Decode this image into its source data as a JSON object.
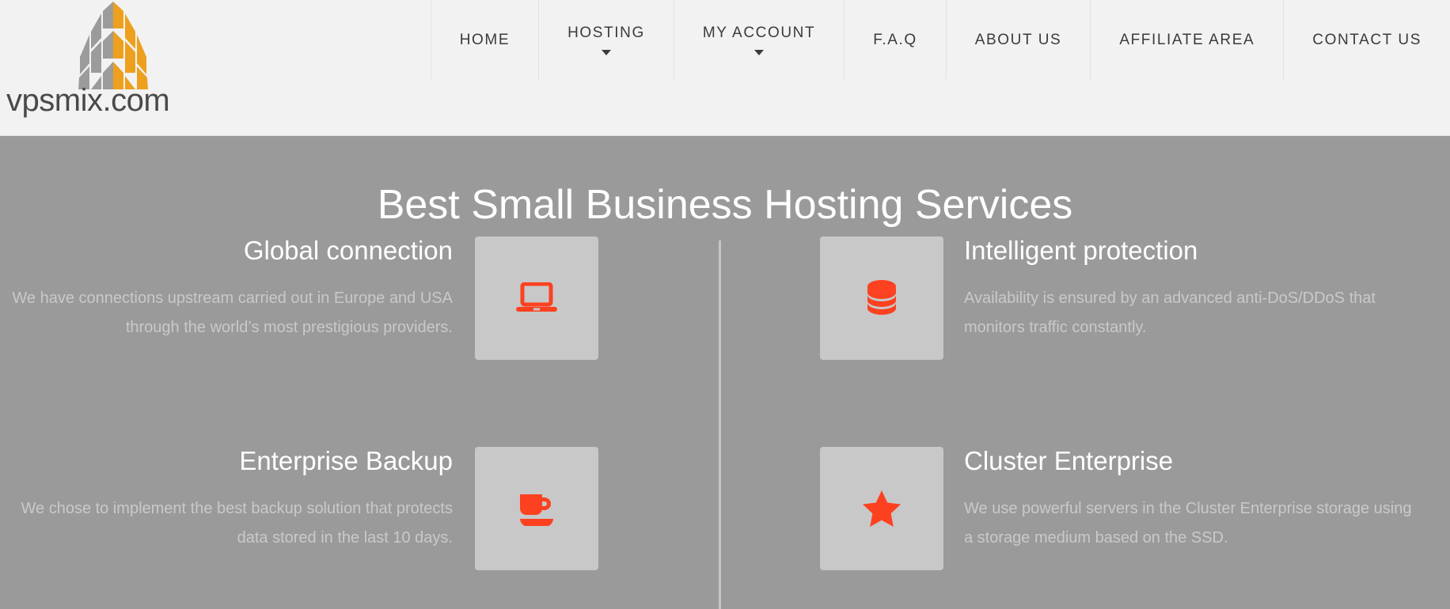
{
  "header": {
    "brand": {
      "name": "vpsmix.com",
      "logo_icon": "building-logo-icon",
      "logo_colors": {
        "gray": "#9b9b9b",
        "orange": "#eda01e"
      }
    },
    "nav": [
      {
        "label": "HOME",
        "has_dropdown": false,
        "icon": ""
      },
      {
        "label": "HOSTING",
        "has_dropdown": true,
        "icon": "chevron-down-icon"
      },
      {
        "label": "MY ACCOUNT",
        "has_dropdown": true,
        "icon": "chevron-down-icon"
      },
      {
        "label": "F.A.Q",
        "has_dropdown": false,
        "icon": ""
      },
      {
        "label": "ABOUT US",
        "has_dropdown": false,
        "icon": ""
      },
      {
        "label": "AFFILIATE AREA",
        "has_dropdown": false,
        "icon": ""
      },
      {
        "label": "CONTACT US",
        "has_dropdown": false,
        "icon": ""
      }
    ]
  },
  "hero": {
    "title": "Best Small Business Hosting Services",
    "background_color": "#9a9a9a",
    "accent_color": "#fc4120",
    "icon_box_color": "#c8c8c8",
    "divider_color": "#c6c6c6",
    "features": [
      {
        "id": "global-connection",
        "side": "left",
        "row": 0,
        "title": "Global connection",
        "description": "We have connections upstream carried out in Europe and USA through the world’s most prestigious providers.",
        "icon": "laptop-icon"
      },
      {
        "id": "intelligent-protection",
        "side": "right",
        "row": 0,
        "title": "Intelligent protection",
        "description": "Availability is ensured by an advanced anti-DoS/DDoS that monitors traffic constantly.",
        "icon": "database-stack-icon"
      },
      {
        "id": "enterprise-backup",
        "side": "left",
        "row": 1,
        "title": "Enterprise Backup",
        "description": "We chose to implement the best backup solution that protects data stored in the last 10 days.",
        "icon": "coffee-cup-icon"
      },
      {
        "id": "cluster-enterprise",
        "side": "right",
        "row": 1,
        "title": "Cluster Enterprise",
        "description": "We use powerful servers in the Cluster Enterprise storage using a storage medium based on the SSD.",
        "icon": "star-icon"
      }
    ]
  }
}
